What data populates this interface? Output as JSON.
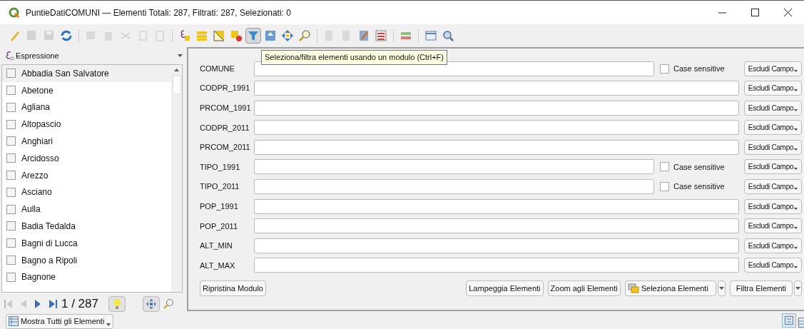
{
  "window": {
    "title": "PuntieDatiCOMUNI — Elementi Totali: 287, Filtrati: 287, Selezionati: 0"
  },
  "toolbar": [
    {
      "kind": "pencil",
      "enabled": true,
      "pressed": false
    },
    {
      "kind": "edit",
      "enabled": false,
      "pressed": false
    },
    {
      "kind": "save",
      "enabled": false,
      "pressed": false
    },
    {
      "kind": "reload",
      "enabled": true,
      "pressed": false
    },
    {
      "kind": "sep"
    },
    {
      "kind": "add",
      "enabled": false,
      "pressed": false
    },
    {
      "kind": "delete",
      "enabled": false,
      "pressed": false
    },
    {
      "kind": "cut",
      "enabled": false,
      "pressed": false
    },
    {
      "kind": "copy",
      "enabled": false,
      "pressed": false
    },
    {
      "kind": "paste",
      "enabled": false,
      "pressed": false
    },
    {
      "kind": "sep"
    },
    {
      "kind": "expr",
      "enabled": true,
      "pressed": false
    },
    {
      "kind": "selectall",
      "enabled": true,
      "pressed": false
    },
    {
      "kind": "invert",
      "enabled": true,
      "pressed": false
    },
    {
      "kind": "deselect",
      "enabled": true,
      "pressed": false
    },
    {
      "kind": "filter",
      "enabled": true,
      "pressed": true
    },
    {
      "kind": "movetop",
      "enabled": true,
      "pressed": false
    },
    {
      "kind": "pan",
      "enabled": true,
      "pressed": false
    },
    {
      "kind": "zoom",
      "enabled": true,
      "pressed": false
    },
    {
      "kind": "sep"
    },
    {
      "kind": "newfield",
      "enabled": false,
      "pressed": false
    },
    {
      "kind": "delfield",
      "enabled": false,
      "pressed": false
    },
    {
      "kind": "calc",
      "enabled": true,
      "pressed": false
    },
    {
      "kind": "condformat",
      "enabled": true,
      "pressed": false
    },
    {
      "kind": "sep"
    },
    {
      "kind": "actions",
      "enabled": true,
      "pressed": false
    },
    {
      "kind": "sep"
    },
    {
      "kind": "dock",
      "enabled": true,
      "pressed": false
    },
    {
      "kind": "search",
      "enabled": true,
      "pressed": false
    }
  ],
  "tooltip": "Seleziona/filtra elementi usando un modulo (Ctrl+F)",
  "sidebar": {
    "expression": "Espressione",
    "items": [
      {
        "label": "Abbadia San Salvatore",
        "checked": false,
        "selected": true
      },
      {
        "label": "Abetone",
        "checked": false,
        "selected": false
      },
      {
        "label": "Agliana",
        "checked": false,
        "selected": false
      },
      {
        "label": "Altopascio",
        "checked": false,
        "selected": false
      },
      {
        "label": "Anghiari",
        "checked": false,
        "selected": false
      },
      {
        "label": "Arcidosso",
        "checked": false,
        "selected": false
      },
      {
        "label": "Arezzo",
        "checked": false,
        "selected": false
      },
      {
        "label": "Asciano",
        "checked": false,
        "selected": false
      },
      {
        "label": "Aulla",
        "checked": false,
        "selected": false
      },
      {
        "label": "Badia Tedalda",
        "checked": false,
        "selected": false
      },
      {
        "label": "Bagni di Lucca",
        "checked": false,
        "selected": false
      },
      {
        "label": "Bagno a Ripoli",
        "checked": false,
        "selected": false
      },
      {
        "label": "Bagnone",
        "checked": false,
        "selected": false
      }
    ],
    "counter": "1 / 287",
    "show_button": "Mostra Tutti gli Elementi"
  },
  "form": {
    "rows": [
      {
        "label": "COMUNE",
        "kind": "case",
        "checked": false,
        "case_label": "Case sensitive",
        "button": "Escludi Campo"
      },
      {
        "label": "CODPR_1991",
        "kind": "plain",
        "button": "Escludi Campo"
      },
      {
        "label": "PRCOM_1991",
        "kind": "plain",
        "button": "Escludi Campo"
      },
      {
        "label": "CODPR_2011",
        "kind": "plain",
        "button": "Escludi Campo"
      },
      {
        "label": "PRCOM_2011",
        "kind": "plain",
        "button": "Escludi Campo"
      },
      {
        "label": "TIPO_1991",
        "kind": "case",
        "checked": false,
        "case_label": "Case sensitive",
        "button": "Escludi Campo"
      },
      {
        "label": "TIPO_2011",
        "kind": "case",
        "checked": false,
        "case_label": "Case sensitive",
        "button": "Escludi Campo"
      },
      {
        "label": "POP_1991",
        "kind": "plain",
        "button": "Escludi Campo"
      },
      {
        "label": "POP_2011",
        "kind": "plain",
        "button": "Escludi Campo"
      },
      {
        "label": "ALT_MIN",
        "kind": "plain",
        "button": "Escludi Campo"
      },
      {
        "label": "ALT_MAX",
        "kind": "plain",
        "button": "Escludi Campo"
      }
    ],
    "reset_button": "Ripristina Modulo",
    "flash_button": "Lampeggia Elementi",
    "zoom_button": "Zoom agli Elementi",
    "select_button": "Seleziona Elementi",
    "filter_button": "Filtra Elementi"
  }
}
